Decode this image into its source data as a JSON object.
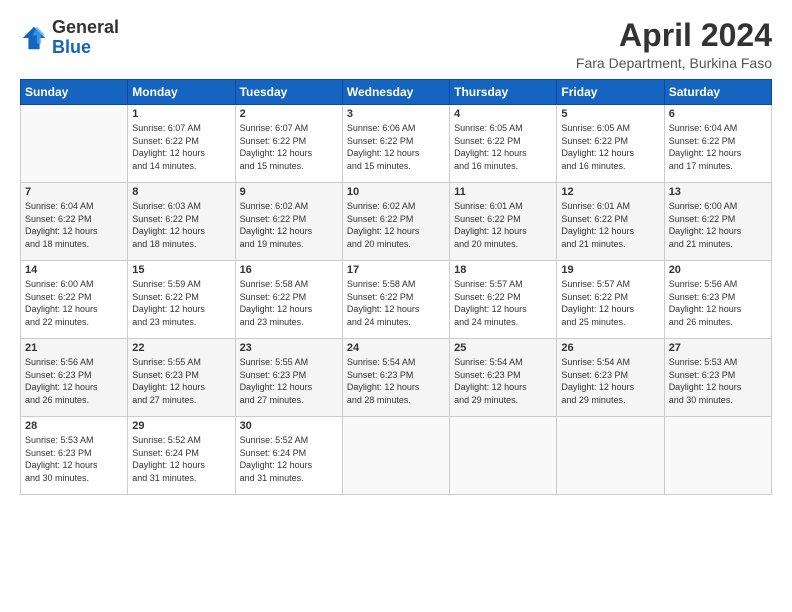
{
  "header": {
    "logo_general": "General",
    "logo_blue": "Blue",
    "month_title": "April 2024",
    "subtitle": "Fara Department, Burkina Faso"
  },
  "days_of_week": [
    "Sunday",
    "Monday",
    "Tuesday",
    "Wednesday",
    "Thursday",
    "Friday",
    "Saturday"
  ],
  "weeks": [
    [
      {
        "day": "",
        "info": ""
      },
      {
        "day": "1",
        "info": "Sunrise: 6:07 AM\nSunset: 6:22 PM\nDaylight: 12 hours\nand 14 minutes."
      },
      {
        "day": "2",
        "info": "Sunrise: 6:07 AM\nSunset: 6:22 PM\nDaylight: 12 hours\nand 15 minutes."
      },
      {
        "day": "3",
        "info": "Sunrise: 6:06 AM\nSunset: 6:22 PM\nDaylight: 12 hours\nand 15 minutes."
      },
      {
        "day": "4",
        "info": "Sunrise: 6:05 AM\nSunset: 6:22 PM\nDaylight: 12 hours\nand 16 minutes."
      },
      {
        "day": "5",
        "info": "Sunrise: 6:05 AM\nSunset: 6:22 PM\nDaylight: 12 hours\nand 16 minutes."
      },
      {
        "day": "6",
        "info": "Sunrise: 6:04 AM\nSunset: 6:22 PM\nDaylight: 12 hours\nand 17 minutes."
      }
    ],
    [
      {
        "day": "7",
        "info": "Sunrise: 6:04 AM\nSunset: 6:22 PM\nDaylight: 12 hours\nand 18 minutes."
      },
      {
        "day": "8",
        "info": "Sunrise: 6:03 AM\nSunset: 6:22 PM\nDaylight: 12 hours\nand 18 minutes."
      },
      {
        "day": "9",
        "info": "Sunrise: 6:02 AM\nSunset: 6:22 PM\nDaylight: 12 hours\nand 19 minutes."
      },
      {
        "day": "10",
        "info": "Sunrise: 6:02 AM\nSunset: 6:22 PM\nDaylight: 12 hours\nand 20 minutes."
      },
      {
        "day": "11",
        "info": "Sunrise: 6:01 AM\nSunset: 6:22 PM\nDaylight: 12 hours\nand 20 minutes."
      },
      {
        "day": "12",
        "info": "Sunrise: 6:01 AM\nSunset: 6:22 PM\nDaylight: 12 hours\nand 21 minutes."
      },
      {
        "day": "13",
        "info": "Sunrise: 6:00 AM\nSunset: 6:22 PM\nDaylight: 12 hours\nand 21 minutes."
      }
    ],
    [
      {
        "day": "14",
        "info": "Sunrise: 6:00 AM\nSunset: 6:22 PM\nDaylight: 12 hours\nand 22 minutes."
      },
      {
        "day": "15",
        "info": "Sunrise: 5:59 AM\nSunset: 6:22 PM\nDaylight: 12 hours\nand 23 minutes."
      },
      {
        "day": "16",
        "info": "Sunrise: 5:58 AM\nSunset: 6:22 PM\nDaylight: 12 hours\nand 23 minutes."
      },
      {
        "day": "17",
        "info": "Sunrise: 5:58 AM\nSunset: 6:22 PM\nDaylight: 12 hours\nand 24 minutes."
      },
      {
        "day": "18",
        "info": "Sunrise: 5:57 AM\nSunset: 6:22 PM\nDaylight: 12 hours\nand 24 minutes."
      },
      {
        "day": "19",
        "info": "Sunrise: 5:57 AM\nSunset: 6:22 PM\nDaylight: 12 hours\nand 25 minutes."
      },
      {
        "day": "20",
        "info": "Sunrise: 5:56 AM\nSunset: 6:23 PM\nDaylight: 12 hours\nand 26 minutes."
      }
    ],
    [
      {
        "day": "21",
        "info": "Sunrise: 5:56 AM\nSunset: 6:23 PM\nDaylight: 12 hours\nand 26 minutes."
      },
      {
        "day": "22",
        "info": "Sunrise: 5:55 AM\nSunset: 6:23 PM\nDaylight: 12 hours\nand 27 minutes."
      },
      {
        "day": "23",
        "info": "Sunrise: 5:55 AM\nSunset: 6:23 PM\nDaylight: 12 hours\nand 27 minutes."
      },
      {
        "day": "24",
        "info": "Sunrise: 5:54 AM\nSunset: 6:23 PM\nDaylight: 12 hours\nand 28 minutes."
      },
      {
        "day": "25",
        "info": "Sunrise: 5:54 AM\nSunset: 6:23 PM\nDaylight: 12 hours\nand 29 minutes."
      },
      {
        "day": "26",
        "info": "Sunrise: 5:54 AM\nSunset: 6:23 PM\nDaylight: 12 hours\nand 29 minutes."
      },
      {
        "day": "27",
        "info": "Sunrise: 5:53 AM\nSunset: 6:23 PM\nDaylight: 12 hours\nand 30 minutes."
      }
    ],
    [
      {
        "day": "28",
        "info": "Sunrise: 5:53 AM\nSunset: 6:23 PM\nDaylight: 12 hours\nand 30 minutes."
      },
      {
        "day": "29",
        "info": "Sunrise: 5:52 AM\nSunset: 6:24 PM\nDaylight: 12 hours\nand 31 minutes."
      },
      {
        "day": "30",
        "info": "Sunrise: 5:52 AM\nSunset: 6:24 PM\nDaylight: 12 hours\nand 31 minutes."
      },
      {
        "day": "",
        "info": ""
      },
      {
        "day": "",
        "info": ""
      },
      {
        "day": "",
        "info": ""
      },
      {
        "day": "",
        "info": ""
      }
    ]
  ]
}
